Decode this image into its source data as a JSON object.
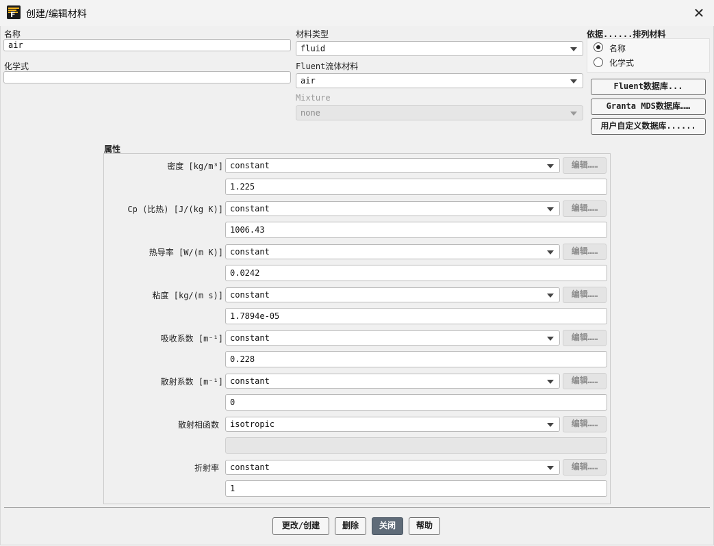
{
  "window": {
    "title": "创建/编辑材料"
  },
  "name": {
    "label": "名称",
    "value": "air"
  },
  "formula": {
    "label": "化学式",
    "value": ""
  },
  "material_type": {
    "label": "材料类型",
    "value": "fluid"
  },
  "fluent_material": {
    "label": "Fluent流体材料",
    "value": "air"
  },
  "mixture": {
    "label": "Mixture",
    "value": "none"
  },
  "sort": {
    "label": "依据......排列材料",
    "options": [
      "名称",
      "化学式"
    ],
    "selected": "名称"
  },
  "databases": {
    "fluent": "Fluent数据库...",
    "granta": "Granta MDS数据库……",
    "user": "用户自定义数据库......"
  },
  "properties": {
    "label": "属性",
    "edit_label": "编辑……",
    "rows": [
      {
        "label": "密度 [kg/m³]",
        "method": "constant",
        "value": "1.225"
      },
      {
        "label": "Cp (比热) [J/(kg K)]",
        "method": "constant",
        "value": "1006.43"
      },
      {
        "label": "热导率 [W/(m K)]",
        "method": "constant",
        "value": "0.0242"
      },
      {
        "label": "粘度 [kg/(m s)]",
        "method": "constant",
        "value": "1.7894e-05"
      },
      {
        "label": "吸收系数 [m⁻¹]",
        "method": "constant",
        "value": "0.228"
      },
      {
        "label": "散射系数 [m⁻¹]",
        "method": "constant",
        "value": "0"
      },
      {
        "label": "散射相函数",
        "method": "isotropic",
        "value": ""
      },
      {
        "label": "折射率",
        "method": "constant",
        "value": "1"
      }
    ]
  },
  "footer": {
    "change": "更改/创建",
    "delete": "删除",
    "close": "关闭",
    "help": "帮助"
  }
}
